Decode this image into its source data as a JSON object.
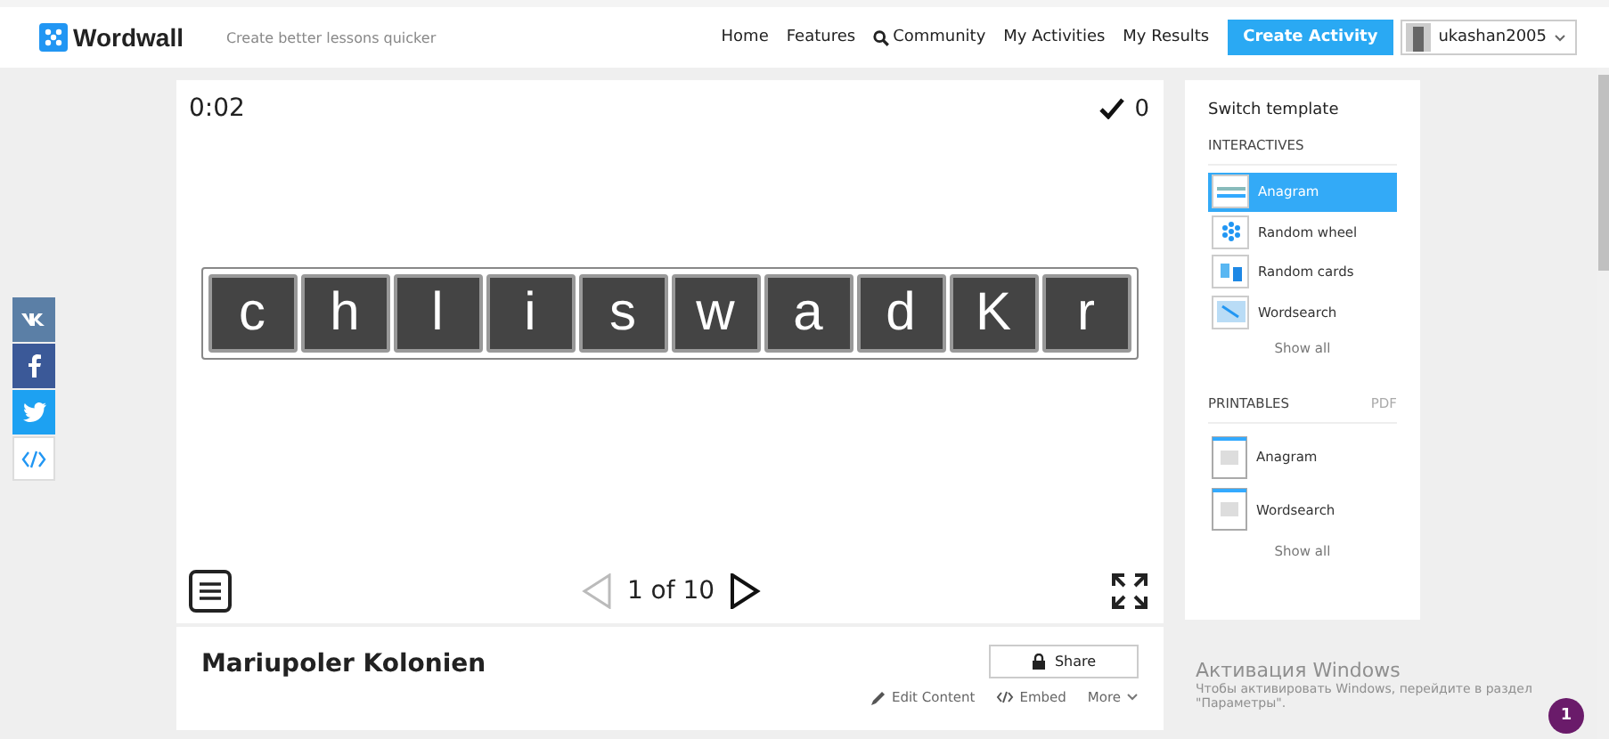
{
  "header": {
    "logo": "Wordwall",
    "tagline": "Create better lessons quicker",
    "nav": [
      "Home",
      "Features",
      "Community",
      "My Activities",
      "My Results"
    ],
    "create_button": "Create Activity",
    "user": "ukashan2005"
  },
  "share_buttons": [
    {
      "kind": "vk"
    },
    {
      "kind": "facebook"
    },
    {
      "kind": "twitter"
    },
    {
      "kind": "embed"
    }
  ],
  "game": {
    "timer": "0:02",
    "score": "0",
    "tiles": [
      "c",
      "h",
      "l",
      "i",
      "s",
      "w",
      "a",
      "d",
      "K",
      "r"
    ],
    "page": "1 of 10"
  },
  "activity": {
    "title": "Mariupoler Kolonien",
    "share": "Share",
    "actions": [
      "Edit Content",
      "Embed",
      "More"
    ]
  },
  "templates": {
    "title": "Switch template",
    "interactives_heading": "INTERACTIVES",
    "interactives": [
      {
        "label": "Anagram",
        "selected": true,
        "kind": "anagram"
      },
      {
        "label": "Random wheel",
        "selected": false,
        "kind": "wheel"
      },
      {
        "label": "Random cards",
        "selected": false,
        "kind": "cards"
      },
      {
        "label": "Wordsearch",
        "selected": false,
        "kind": "wordsearch"
      }
    ],
    "show_all_1": "Show all",
    "printables_heading": "PRINTABLES",
    "pdf": "PDF",
    "printables": [
      "Anagram",
      "Wordsearch"
    ],
    "show_all_2": "Show all"
  },
  "windows_activation": {
    "title": "Активация Windows",
    "text": "Чтобы активировать Windows, перейдите в раздел \"Параметры\"."
  },
  "notification_badge": "1"
}
